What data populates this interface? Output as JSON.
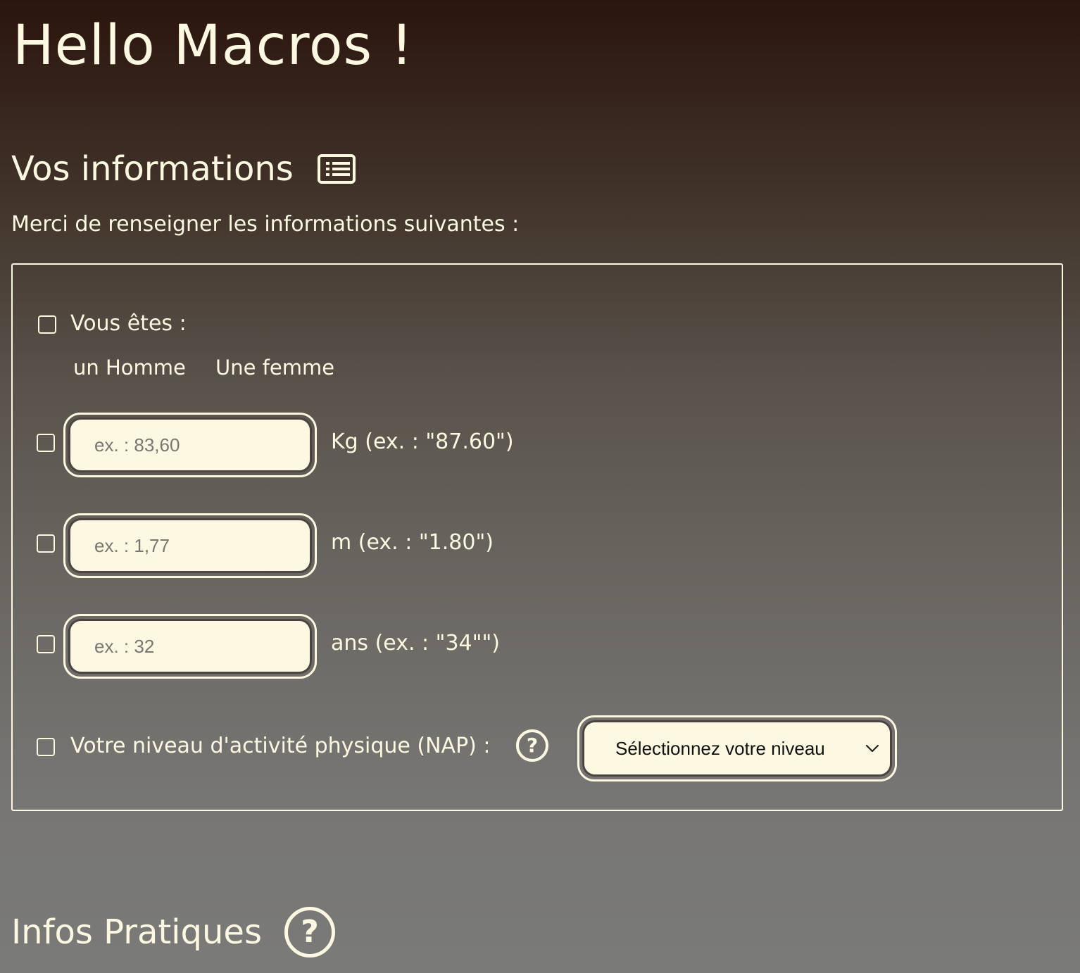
{
  "page": {
    "title": "Hello Macros !"
  },
  "section_info": {
    "title": "Vos informations",
    "icon": "list-icon",
    "subtitle": "Merci de renseigner les informations suivantes :"
  },
  "form": {
    "gender": {
      "label": "Vous êtes :",
      "options": [
        "un Homme",
        "Une femme"
      ]
    },
    "weight": {
      "placeholder": "ex. : 83,60",
      "unit_label": "Kg (ex. : \"87.60\")"
    },
    "height": {
      "placeholder": "ex. : 1,77",
      "unit_label": "m (ex. : \"1.80\")"
    },
    "age": {
      "placeholder": "ex. : 32",
      "unit_label": "ans (ex. : \"34\"\")"
    },
    "activity": {
      "label": "Votre niveau d'activité physique (NAP) :",
      "help_glyph": "?",
      "select_value": "Sélectionnez votre niveau"
    }
  },
  "section_infos": {
    "title": "Infos Pratiques",
    "help_glyph": "?"
  },
  "colors": {
    "text": "#fdf8e1",
    "input_bg": "#fdf8e1",
    "bg_top": "#2b150d",
    "bg_bottom": "#7a7a79"
  }
}
